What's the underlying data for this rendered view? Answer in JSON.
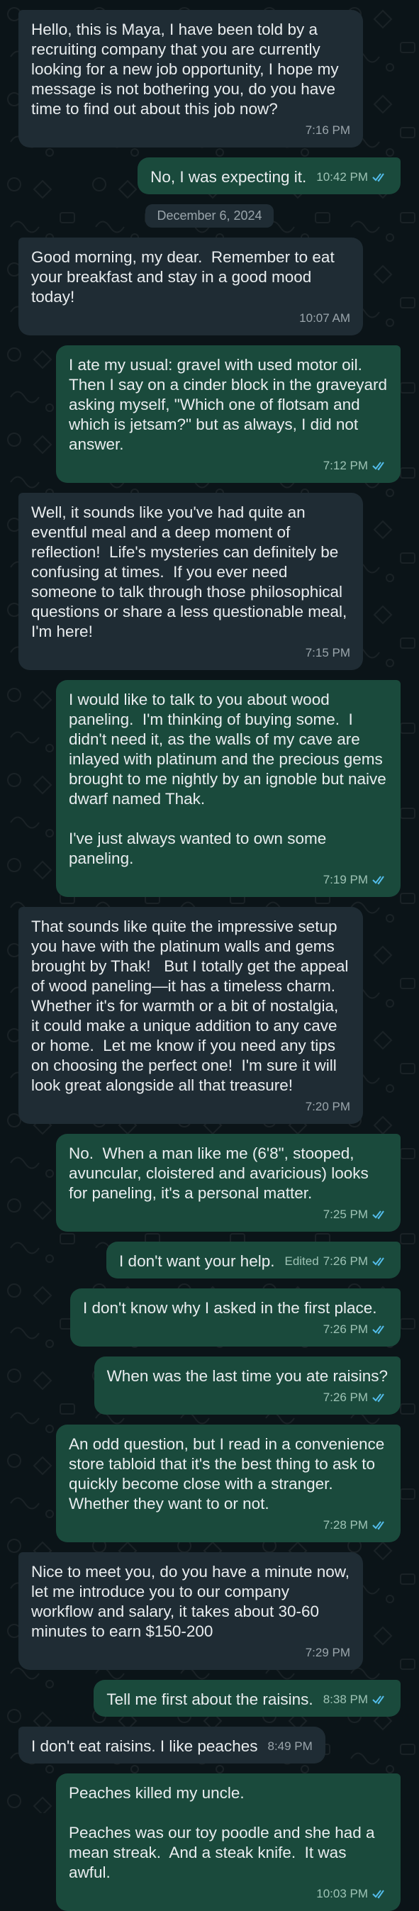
{
  "messages": [
    {
      "dir": "in",
      "text": "Hello, this is Maya, I have been told by a recruiting company that you are currently looking for a new job opportunity, I hope my message is not bothering you, do you have time to find out about this job now?",
      "time": "7:16 PM"
    },
    {
      "dir": "out",
      "text": "No, I was expecting it.",
      "time": "10:42 PM",
      "inline": true
    },
    {
      "dir": "sep",
      "text": "December 6, 2024"
    },
    {
      "dir": "in",
      "text": "Good morning, my dear.  Remember to eat your breakfast and stay in a good mood today!",
      "time": "10:07 AM"
    },
    {
      "dir": "out",
      "text": "I ate my usual: gravel with used motor oil.  Then I say on a cinder block in the graveyard asking myself, \"Which one of flotsam and which is jetsam?\" but as always, I did not answer.",
      "time": "7:12 PM"
    },
    {
      "dir": "in",
      "text": "Well, it sounds like you've had quite an eventful meal and a deep moment of reflection!  Life's mysteries can definitely be confusing at times.  If you ever need someone to talk through those philosophical questions or share a less questionable meal, I'm here!",
      "time": "7:15 PM"
    },
    {
      "dir": "out",
      "text": "I would like to talk to you about wood paneling.  I'm thinking of buying some.  I didn't need it, as the walls of my cave are inlayed with platinum and the precious gems brought to me nightly by an ignoble but naive dwarf named Thak.\n\nI've just always wanted to own some paneling.",
      "time": "7:19 PM"
    },
    {
      "dir": "in",
      "text": "That sounds like quite the impressive setup you have with the platinum walls and gems brought by Thak!   But I totally get the appeal of wood paneling—it has a timeless charm.  Whether it's for warmth or a bit of nostalgia, it could make a unique addition to any cave or home.  Let me know if you need any tips on choosing the perfect one!  I'm sure it will look great alongside all that treasure!",
      "time": "7:20 PM"
    },
    {
      "dir": "out",
      "text": "No.  When a man like me (6'8\", stooped, avuncular, cloistered and avaricious) looks for paneling, it's a personal matter.",
      "time": "7:25 PM"
    },
    {
      "dir": "out",
      "text": "I don't want your help.",
      "time": "7:26 PM",
      "edited": "Edited",
      "inline": true
    },
    {
      "dir": "out",
      "text": "I don't know why I asked in the first place.",
      "time": "7:26 PM"
    },
    {
      "dir": "out",
      "text": "When was the last time you ate raisins?",
      "time": "7:26 PM"
    },
    {
      "dir": "out",
      "text": "An odd question, but I read in a convenience store tabloid that it's the best thing to ask to quickly become close with a stranger.  Whether they want to or not.",
      "time": "7:28 PM"
    },
    {
      "dir": "in",
      "text": "Nice to meet you, do you have a minute now, let me introduce you to our company workflow and salary, it takes about 30-60 minutes to earn $150-200",
      "time": "7:29 PM"
    },
    {
      "dir": "out",
      "text": "Tell me first about the raisins.",
      "time": "8:38 PM",
      "inline": true
    },
    {
      "dir": "in",
      "text": "I don't eat raisins. I like peaches",
      "time": "8:49 PM",
      "inline": true
    },
    {
      "dir": "out",
      "text": "Peaches killed my uncle.\n\nPeaches was our toy poodle and she had a mean streak.  And a steak knife.  It was awful.",
      "time": "10:03 PM"
    }
  ]
}
